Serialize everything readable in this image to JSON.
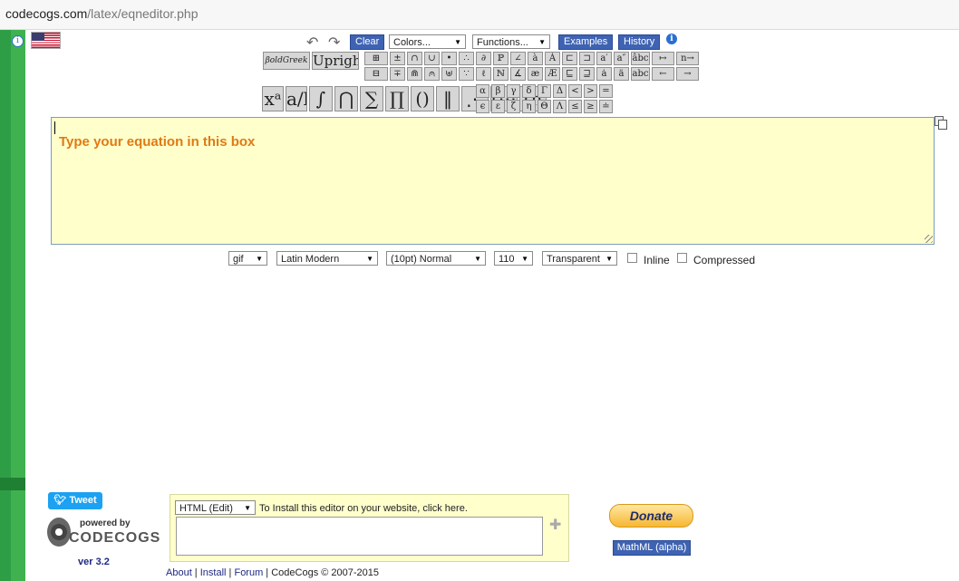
{
  "address_bar": {
    "domain": "codecogs.com",
    "path": "/latex/eqneditor.php"
  },
  "toolbar": {
    "clear_label": "Clear",
    "colors_select": "Colors...",
    "functions_select": "Functions...",
    "examples_label": "Examples",
    "history_label": "History",
    "info_glyph": "i"
  },
  "symbol_buttons": {
    "bold_greek": "βoldGreek",
    "upright": "Upright",
    "row1": [
      "⊞",
      "±",
      "∩",
      "∪",
      "•",
      "∴",
      "∂",
      "ℙ",
      "∠",
      "à",
      "Á",
      "⊏",
      "⊐",
      "a′",
      "a″",
      "âbc",
      "↦",
      "n→"
    ],
    "row2": [
      "⊟",
      "∓",
      "⋒",
      "⩀",
      "⊎",
      "∵",
      "ℓ",
      "ℕ",
      "∡",
      "æ",
      "Æ",
      "⊑",
      "⊒",
      "ȧ",
      "ä",
      "abc",
      "←",
      "→"
    ],
    "big": [
      "xᵃ",
      "a/b",
      "∫",
      "⋂",
      "∑",
      "∏",
      "()",
      "‖",
      "⋰",
      "[⋯]",
      "(n r)"
    ],
    "greek_row1": [
      "α",
      "β",
      "γ",
      "δ",
      "Γ",
      "Δ",
      "<",
      ">",
      "="
    ],
    "greek_row2": [
      "ϵ",
      "ε",
      "ζ",
      "η",
      "Θ",
      "Λ",
      "≤",
      "≥",
      "≐"
    ]
  },
  "editor": {
    "placeholder": "Type your equation in this box"
  },
  "options": {
    "format": "gif",
    "font": "Latin Modern",
    "size": "(10pt) Normal",
    "dpi": "110",
    "background": "Transparent",
    "inline_label": "Inline",
    "compressed_label": "Compressed"
  },
  "left_panel": {
    "tweet_label": "Tweet",
    "powered_by": "powered by",
    "brand": "CODECOGS",
    "version": "ver 3.2"
  },
  "install": {
    "mode": "HTML (Edit)",
    "note": "To Install this editor on your website, click here."
  },
  "donate_label": "Donate",
  "mathml_label": "MathML (alpha)",
  "footer": {
    "about": "About",
    "install": "Install",
    "forum": "Forum",
    "copyright": "CodeCogs © 2007-2015"
  },
  "icons": [
    "info-icon",
    "us-flag-icon",
    "undo-icon",
    "redo-icon",
    "copy-icon",
    "puzzle-icon",
    "resize-grip-icon"
  ]
}
